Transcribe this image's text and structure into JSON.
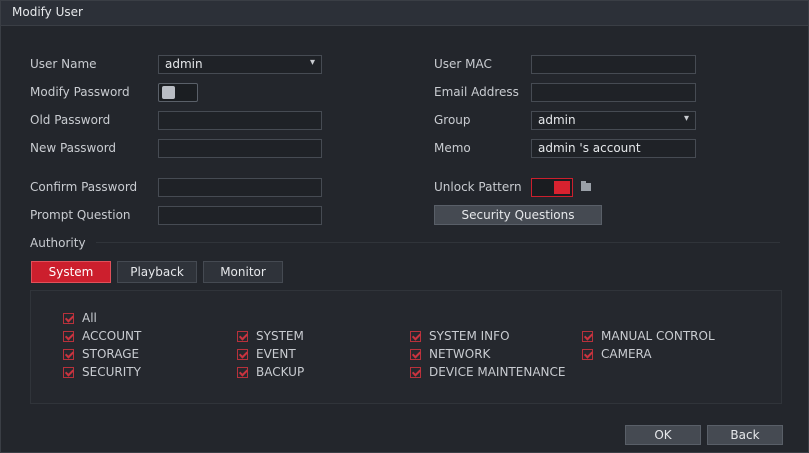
{
  "title": "Modify User",
  "labels": {
    "user_name": "User Name",
    "modify_password": "Modify Password",
    "old_password": "Old Password",
    "new_password": "New Password",
    "confirm_password": "Confirm Password",
    "prompt_question": "Prompt Question",
    "user_mac": "User MAC",
    "email_address": "Email Address",
    "group": "Group",
    "memo": "Memo",
    "unlock_pattern": "Unlock Pattern",
    "authority": "Authority"
  },
  "values": {
    "user_name": "admin",
    "group": "admin",
    "memo": "admin 's account",
    "user_mac": "",
    "email_address": "",
    "old_password": "",
    "new_password": "",
    "confirm_password": "",
    "prompt_question": ""
  },
  "buttons": {
    "security_questions": "Security Questions",
    "ok": "OK",
    "back": "Back"
  },
  "tabs": [
    "System",
    "Playback",
    "Monitor"
  ],
  "active_tab": "System",
  "permissions": {
    "all": "All",
    "items": [
      "ACCOUNT",
      "SYSTEM",
      "SYSTEM INFO",
      "MANUAL CONTROL",
      "STORAGE",
      "EVENT",
      "NETWORK",
      "CAMERA",
      "SECURITY",
      "BACKUP",
      "DEVICE MAINTENANCE"
    ]
  },
  "colors": {
    "accent": "#cc1f2d",
    "background": "#23262c"
  }
}
